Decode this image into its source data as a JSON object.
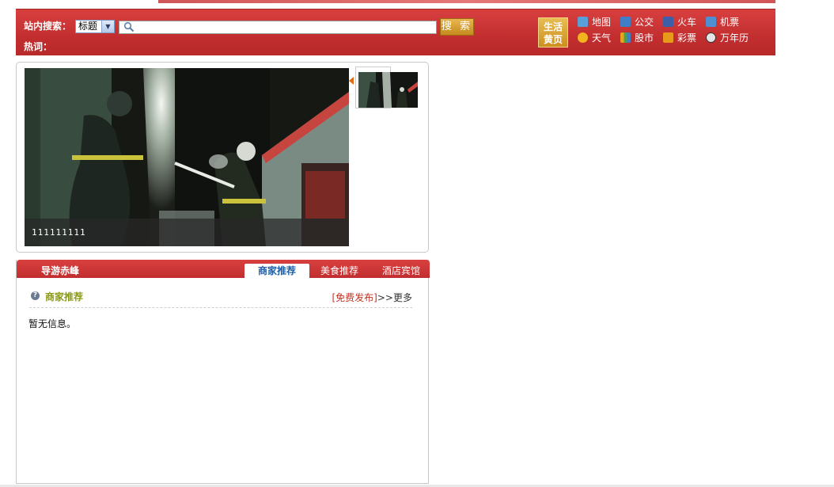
{
  "search": {
    "label": "站内搜索：",
    "select_value": "标题",
    "input_value": "",
    "button_label": "搜 索",
    "hot_label": "热词："
  },
  "life_yellow_pages": {
    "line1": "生活",
    "line2": "黄页"
  },
  "quick_links": [
    {
      "label": "地图",
      "icon": "map-icon",
      "color": "#5aa0d8"
    },
    {
      "label": "公交",
      "icon": "bus-icon",
      "color": "#3f7fc8"
    },
    {
      "label": "火车",
      "icon": "train-icon",
      "color": "#3c5fa8"
    },
    {
      "label": "机票",
      "icon": "plane-icon",
      "color": "#4d8fd0"
    },
    {
      "label": "天气",
      "icon": "sun-icon",
      "color": "#f2b51e"
    },
    {
      "label": "股市",
      "icon": "stock-icon",
      "color": "#e8a21c"
    },
    {
      "label": "彩票",
      "icon": "lottery-icon",
      "color": "#e89b1a"
    },
    {
      "label": "万年历",
      "icon": "clock-icon",
      "color": "#e4e4e4"
    }
  ],
  "slideshow": {
    "caption": "111111111"
  },
  "guide": {
    "title": "导游赤峰",
    "tabs": [
      {
        "label": "商家推荐",
        "active": true
      },
      {
        "label": "美食推荐",
        "active": false
      },
      {
        "label": "酒店宾馆",
        "active": false
      }
    ],
    "section_title": "商家推荐",
    "free_post": "[免费发布]",
    "more": ">>更多",
    "empty_text": "暂无信息。"
  },
  "colors": {
    "header_red": "#c22e2f",
    "accent_gold": "#cc8f1e",
    "tab_active_text": "#1e5fa8",
    "section_title": "#8a9a12"
  }
}
